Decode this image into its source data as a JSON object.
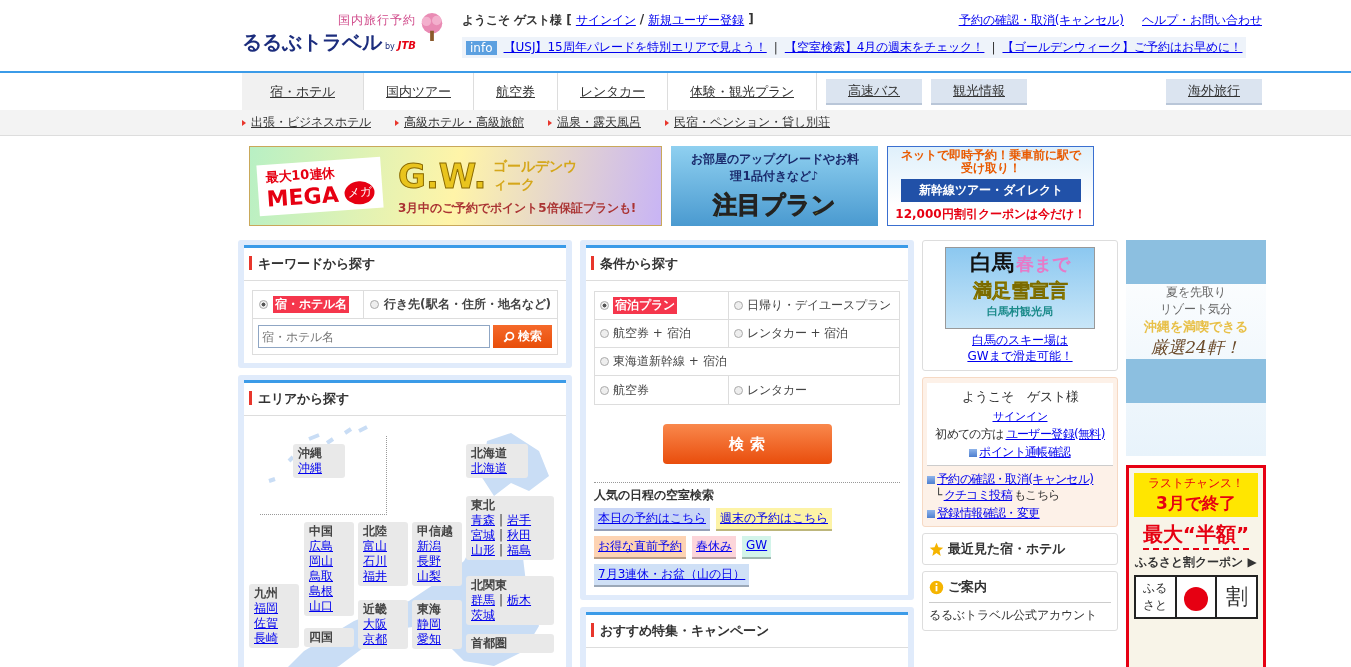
{
  "logo": {
    "tagline": "国内旅行予約",
    "name": "るるぶトラベル",
    "by": "by",
    "partner": "JTB"
  },
  "welcome": [
    {
      "kind": "text",
      "text": "ようこそ ゲスト様 ["
    },
    {
      "kind": "link",
      "text": "サインイン"
    },
    {
      "kind": "text",
      "text": "/"
    },
    {
      "kind": "link",
      "text": "新規ユーザー登録"
    },
    {
      "kind": "text",
      "text": "]"
    }
  ],
  "top_links": [
    "予約の確認・取消(キャンセル)",
    "ヘルプ・お問い合わせ"
  ],
  "info": {
    "badge": "info",
    "separator": "|",
    "news": [
      "【USJ】15周年パレードを特別エリアで見よう！",
      "【空室検索】4月の週末をチェック！",
      "【ゴールデンウィーク】ご予約はお早めに！"
    ]
  },
  "tabs": [
    {
      "label": "宿・ホテル",
      "kind": "tab",
      "selected": true
    },
    {
      "label": "国内ツアー",
      "kind": "tab",
      "selected": false
    },
    {
      "label": "航空券",
      "kind": "tab",
      "selected": false
    },
    {
      "label": "レンタカー",
      "kind": "tab",
      "selected": false
    },
    {
      "label": "体験・観光プラン",
      "kind": "tab",
      "selected": false
    },
    {
      "label": "高速バス",
      "kind": "button",
      "selected": false
    },
    {
      "label": "観光情報",
      "kind": "button",
      "selected": false
    },
    {
      "label": "海外旅行",
      "kind": "far",
      "selected": false
    }
  ],
  "sub_links": [
    "出張・ビジネスホテル",
    "高級ホテル・高級旅館",
    "温泉・露天風呂",
    "民宿・ペンション・貸し別荘"
  ],
  "banners": [
    {
      "kind": "gw",
      "texts": [
        "最大10連休",
        "MEGA",
        "メガ",
        "G.W.",
        "ゴールデンウィーク",
        "3月中のご予約でポイント5倍保証プランも!"
      ]
    },
    {
      "kind": "plan",
      "texts": [
        "お部屋のアップグレードやお料理1品付きなど♪",
        "注目プラン"
      ]
    },
    {
      "kind": "shinkansen",
      "texts": [
        "ネットで即時予約！乗車前に駅で受け取り！",
        "新幹線ツアー・ダイレクト",
        "12,000円割引クーポンは今だけ！"
      ]
    }
  ],
  "keyword": {
    "title": "キーワードから探す",
    "options": [
      {
        "label": "宿・ホテル名",
        "selected": true
      },
      {
        "label": "行き先(駅名・住所・地名など)",
        "selected": false
      }
    ],
    "placeholder": "宿・ホテル名",
    "button": "検索"
  },
  "area": {
    "title": "エリアから探す",
    "separator": "|",
    "regions": [
      {
        "name": "沖縄",
        "rows": [
          [
            "沖縄"
          ]
        ]
      },
      {
        "name": "北海道",
        "rows": [
          [
            "北海道"
          ]
        ]
      },
      {
        "name": "東北",
        "rows": [
          [
            "青森",
            "岩手"
          ],
          [
            "宮城",
            "秋田"
          ],
          [
            "山形",
            "福島"
          ]
        ]
      },
      {
        "name": "中国",
        "rows": [
          [
            "広島"
          ],
          [
            "岡山"
          ],
          [
            "鳥取"
          ],
          [
            "島根"
          ],
          [
            "山口"
          ]
        ]
      },
      {
        "name": "北陸",
        "rows": [
          [
            "富山"
          ],
          [
            "石川"
          ],
          [
            "福井"
          ]
        ]
      },
      {
        "name": "甲信越",
        "rows": [
          [
            "新潟"
          ],
          [
            "長野"
          ],
          [
            "山梨"
          ]
        ]
      },
      {
        "name": "北関東",
        "rows": [
          [
            "群馬",
            "栃木"
          ],
          [
            "茨城"
          ]
        ]
      },
      {
        "name": "九州",
        "rows": [
          [
            "福岡"
          ],
          [
            "佐賀"
          ],
          [
            "長崎"
          ]
        ]
      },
      {
        "name": "四国"
      },
      {
        "name": "近畿",
        "rows": [
          [
            "大阪"
          ],
          [
            "京都"
          ]
        ]
      },
      {
        "name": "東海",
        "rows": [
          [
            "静岡"
          ],
          [
            "愛知"
          ]
        ]
      },
      {
        "name": "首都圏"
      }
    ]
  },
  "conditions": {
    "title": "条件から探す",
    "options": [
      {
        "label": "宿泊プラン",
        "kind": "half",
        "selected": true
      },
      {
        "label": "日帰り・デイユースプラン",
        "kind": "half",
        "selected": false
      },
      {
        "label": "航空券 + 宿泊",
        "kind": "half",
        "selected": false
      },
      {
        "label": "レンタカー + 宿泊",
        "kind": "half",
        "selected": false
      },
      {
        "label": "東海道新幹線 + 宿泊",
        "kind": "full",
        "selected": false
      },
      {
        "label": "航空券",
        "kind": "half",
        "selected": false
      },
      {
        "label": "レンタカー",
        "kind": "half",
        "selected": false
      }
    ],
    "button": "検 索",
    "popular_title": "人気の日程の空室検索",
    "popular": [
      {
        "label": "本日の予約はこちら",
        "color": "#c9d6f6"
      },
      {
        "label": "週末の予約はこちら",
        "color": "#fdf3a6"
      },
      {
        "label": "お得な直前予約",
        "color": "#fdd3b3"
      },
      {
        "label": "春休み",
        "color": "#fcd5da"
      },
      {
        "label": "GW",
        "color": "#d3f4ea"
      },
      {
        "label": "7月3連休・お盆（山の日）",
        "color": "#cfe0f6"
      }
    ]
  },
  "recommend": {
    "title": "おすすめ特集・キャンペーン"
  },
  "hakuba": {
    "texts": [
      "白馬",
      "春まで",
      "満足雪宣言",
      "白馬村観光局"
    ],
    "link_lines": [
      "白馬のスキー場は",
      "GWまで滑走可能！"
    ]
  },
  "member": {
    "greeting": "ようこそ　ゲスト様",
    "signin": "サインイン",
    "first_text": "初めての方は",
    "register": "ユーザー登録(無料)",
    "points": "ポイント通帳確認",
    "reservation": "予約の確認・取消(キャンセル)",
    "corner": "└",
    "review": "クチコミ投稿",
    "review_suffix": "もこちら",
    "profile": "登録情報確認・変更"
  },
  "recent": {
    "title": "最近見た宿・ホテル"
  },
  "notice": {
    "title": "ご案内",
    "text": "るるぶトラベル公式アカウント"
  },
  "ads": [
    {
      "kind": "okinawa",
      "texts": [
        "夏を先取り",
        "リゾート気分",
        "沖縄を満喫できる",
        "厳選24軒！"
      ]
    },
    {
      "kind": "furusato",
      "texts": [
        "ラストチャンス！",
        "3月で終了",
        "最大“半額”",
        "ふるさと割クーポン ▶",
        "ふる",
        "さと",
        "割"
      ]
    }
  ]
}
